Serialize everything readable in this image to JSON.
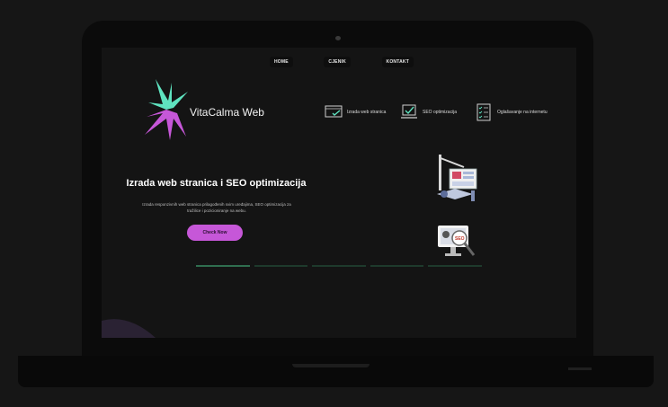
{
  "nav": {
    "items": [
      "HOME",
      "CJENIK",
      "KONTAKT"
    ]
  },
  "brand": {
    "name": "VitaCalma Web"
  },
  "services": [
    {
      "label": "Izrada web stranica",
      "icon": "monitor-check-icon"
    },
    {
      "label": "SEO optimizacija",
      "icon": "laptop-check-icon"
    },
    {
      "label": "Oglašavanje na internetu",
      "icon": "checklist-icon"
    }
  ],
  "hero": {
    "title": "Izrada web stranica i SEO optimizacija",
    "description": "Izrada responzivnih web stranica prilagođenih svim uređajima, SEO optimizacija za tražilice i pozicioniranje na webu.",
    "cta_label": "Check Now"
  },
  "carousel": {
    "slides": 5,
    "active": 0
  },
  "colors": {
    "accent_purple": "#c657d8",
    "accent_teal": "#5fe3c0",
    "background": "#141414"
  }
}
